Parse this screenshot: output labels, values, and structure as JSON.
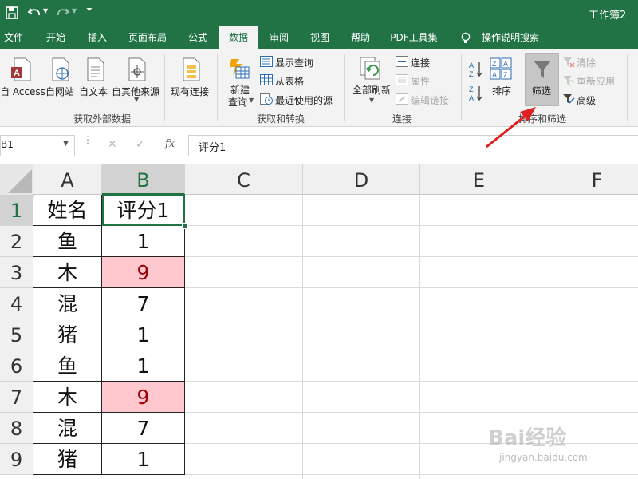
{
  "window": {
    "title": "工作簿2"
  },
  "tabs": [
    "文件",
    "开始",
    "插入",
    "页面布局",
    "公式",
    "数据",
    "审阅",
    "视图",
    "帮助",
    "PDF工具集"
  ],
  "active_tab": "数据",
  "tell_me": "操作说明搜索",
  "ribbon": {
    "get_external": {
      "access": "自 Access",
      "web": "自网站",
      "text": "自文本",
      "other": "自其他来源",
      "existing": "现有连接",
      "group": "获取外部数据"
    },
    "get_transform": {
      "new_query": "新建",
      "new_query_2": "查询",
      "show_queries": "显示查询",
      "from_table": "从表格",
      "recent_sources": "最近使用的源",
      "group": "获取和转换"
    },
    "connections": {
      "refresh_all": "全部刷新",
      "connections": "连接",
      "properties": "属性",
      "edit_links": "编辑链接",
      "group": "连接"
    },
    "sort_filter": {
      "sort": "排序",
      "filter": "筛选",
      "clear": "清除",
      "reapply": "重新应用",
      "advanced": "高级",
      "group": "排序和筛选"
    }
  },
  "formula_bar": {
    "name_box": "B1",
    "cancel": "✕",
    "enter": "✓",
    "fx": "fx",
    "content": "评分1"
  },
  "columns": [
    "A",
    "B",
    "C",
    "D",
    "E",
    "F"
  ],
  "rows": [
    {
      "num": "1",
      "a": "姓名",
      "b": "评分1",
      "pink": false
    },
    {
      "num": "2",
      "a": "鱼",
      "b": "1",
      "pink": false
    },
    {
      "num": "3",
      "a": "木",
      "b": "9",
      "pink": true
    },
    {
      "num": "4",
      "a": "混",
      "b": "7",
      "pink": false
    },
    {
      "num": "5",
      "a": "猪",
      "b": "1",
      "pink": false
    },
    {
      "num": "6",
      "a": "鱼",
      "b": "1",
      "pink": false
    },
    {
      "num": "7",
      "a": "木",
      "b": "9",
      "pink": true
    },
    {
      "num": "8",
      "a": "混",
      "b": "7",
      "pink": false
    },
    {
      "num": "9",
      "a": "猪",
      "b": "1",
      "pink": false
    }
  ],
  "watermark": {
    "brand": "Bai经验",
    "url": "jingyan.baidu.com"
  },
  "colors": {
    "excel_green": "#217346",
    "pink_fill": "#ffc7ce",
    "pink_text": "#9c0006",
    "arrow_red": "#e0201f"
  }
}
